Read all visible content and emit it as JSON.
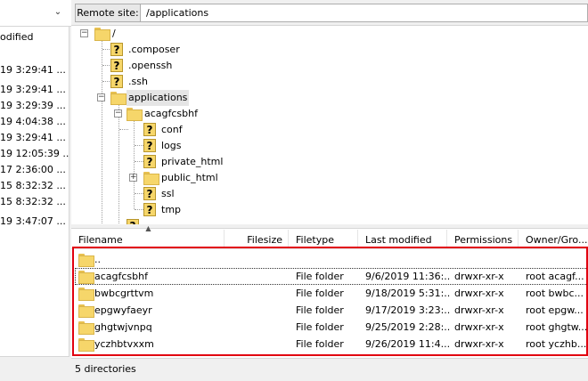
{
  "local": {
    "column_header": "odified",
    "rows": [
      "19 3:29:41 ...",
      "19 3:29:41 ...",
      "19 3:29:39 ...",
      "19 4:04:38 ...",
      "19 3:29:41 ...",
      "19 12:05:39 ...",
      "17 2:36:00 ...",
      "15 8:32:32 ...",
      "15 8:32:32 ...",
      "19 3:47:07 ..."
    ]
  },
  "remote": {
    "label": "Remote site:",
    "path": "/applications"
  },
  "tree": {
    "root": "/",
    "items": [
      {
        "label": ".composer",
        "icon": "unknown-icon"
      },
      {
        "label": ".openssh",
        "icon": "unknown-icon"
      },
      {
        "label": ".ssh",
        "icon": "unknown-icon"
      },
      {
        "label": "applications",
        "icon": "folder-icon",
        "selected": true
      },
      {
        "label": "acagfcsbhf",
        "icon": "folder-icon"
      },
      {
        "label": "conf",
        "icon": "unknown-icon"
      },
      {
        "label": "logs",
        "icon": "unknown-icon"
      },
      {
        "label": "private_html",
        "icon": "unknown-icon"
      },
      {
        "label": "public_html",
        "icon": "folder-icon"
      },
      {
        "label": "ssl",
        "icon": "unknown-icon"
      },
      {
        "label": "tmp",
        "icon": "unknown-icon"
      }
    ]
  },
  "filelist": {
    "columns": {
      "filename": "Filename",
      "filesize": "Filesize",
      "filetype": "Filetype",
      "modified": "Last modified",
      "permissions": "Permissions",
      "owner": "Owner/Gro..."
    },
    "parent": "..",
    "rows": [
      {
        "name": "acagfcsbhf",
        "type": "File folder",
        "modified": "9/6/2019 11:36:...",
        "perms": "drwxr-xr-x",
        "owner": "root acagf..."
      },
      {
        "name": "bwbcgrttvm",
        "type": "File folder",
        "modified": "9/18/2019 5:31:...",
        "perms": "drwxr-xr-x",
        "owner": "root bwbc..."
      },
      {
        "name": "epgwyfaeyr",
        "type": "File folder",
        "modified": "9/17/2019 3:23:...",
        "perms": "drwxr-xr-x",
        "owner": "root epgw..."
      },
      {
        "name": "ghgtwjvnpq",
        "type": "File folder",
        "modified": "9/25/2019 2:28:...",
        "perms": "drwxr-xr-x",
        "owner": "root ghgtw..."
      },
      {
        "name": "yczhbtvxxm",
        "type": "File folder",
        "modified": "9/26/2019 11:4...",
        "perms": "drwxr-xr-x",
        "owner": "root yczhb..."
      }
    ]
  },
  "status": {
    "text": "5 directories"
  },
  "colors": {
    "highlight": "#e1000f",
    "folder": "#f6d66a"
  }
}
